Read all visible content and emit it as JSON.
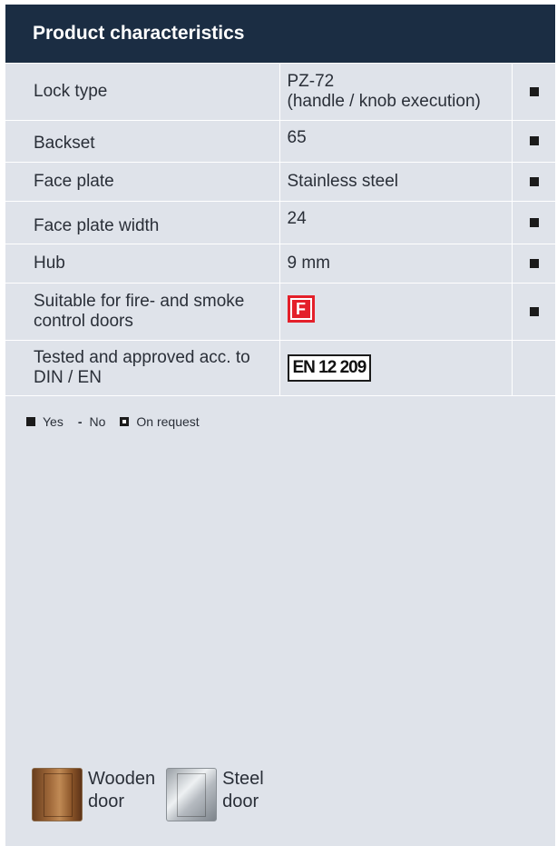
{
  "header": {
    "title": "Product characteristics"
  },
  "rows": [
    {
      "label": "Lock type",
      "value_line1": "PZ-72",
      "value_line2": "(handle / knob execution)",
      "status": "Yes"
    },
    {
      "label": "Backset",
      "value": "65",
      "status": "Yes"
    },
    {
      "label": "Face plate",
      "value": "Stainless steel",
      "status": "Yes"
    },
    {
      "label": "Face plate width",
      "value": "24",
      "status": "Yes"
    },
    {
      "label": "Hub",
      "value": "9 mm",
      "status": "Yes"
    },
    {
      "label_line1": "Suitable for fire- and smoke",
      "label_line2": "control doors",
      "badge": "F",
      "status": "Yes"
    },
    {
      "label_line1": "Tested and approved acc. to",
      "label_line2": "DIN / EN",
      "badge": "EN 12 209"
    }
  ],
  "legend": {
    "yes": "Yes",
    "dash": "-",
    "no": "No",
    "on_request": "On request"
  },
  "doors": [
    {
      "line1": "Wooden",
      "line2": "door",
      "icon": "wooden-door-icon"
    },
    {
      "line1": "Steel",
      "line2": "door",
      "icon": "steel-door-icon"
    }
  ],
  "colors": {
    "header_bg": "#1b2d43",
    "panel_bg": "#dfe3ea",
    "fire_badge": "#e4202a"
  }
}
